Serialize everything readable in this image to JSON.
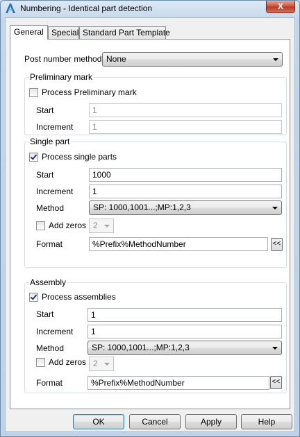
{
  "window": {
    "title": "Numbering - Identical part detection",
    "close_label": "X"
  },
  "tabs": [
    "General",
    "Special",
    "Standard Part Template"
  ],
  "post_number": {
    "label": "Post number method",
    "value": "None"
  },
  "preliminary": {
    "title": "Preliminary mark",
    "checkbox_label": "Process Preliminary mark",
    "checked": false,
    "start_label": "Start",
    "start_value": "1",
    "increment_label": "Increment",
    "increment_value": "1"
  },
  "single": {
    "title": "Single part",
    "checkbox_label": "Process single parts",
    "checked": true,
    "start_label": "Start",
    "start_value": "1000",
    "increment_label": "Increment",
    "increment_value": "1",
    "method_label": "Method",
    "method_value": "SP: 1000,1001...;MP:1,2,3",
    "zeros_label": "Add zeros",
    "zeros_checked": false,
    "zeros_value": "2",
    "format_label": "Format",
    "format_value": "%Prefix%MethodNumber",
    "format_btn": "<<"
  },
  "assembly": {
    "title": "Assembly",
    "checkbox_label": "Process assemblies",
    "checked": true,
    "start_label": "Start",
    "start_value": "1",
    "increment_label": "Increment",
    "increment_value": "1",
    "method_label": "Method",
    "method_value": "SP: 1000,1001...;MP:1,2,3",
    "zeros_label": "Add zeros",
    "zeros_checked": false,
    "zeros_value": "2",
    "format_label": "Format",
    "format_value": "%Prefix%MethodNumber",
    "format_btn": "<<"
  },
  "buttons": {
    "ok": "OK",
    "cancel": "Cancel",
    "apply": "Apply",
    "help": "Help"
  }
}
